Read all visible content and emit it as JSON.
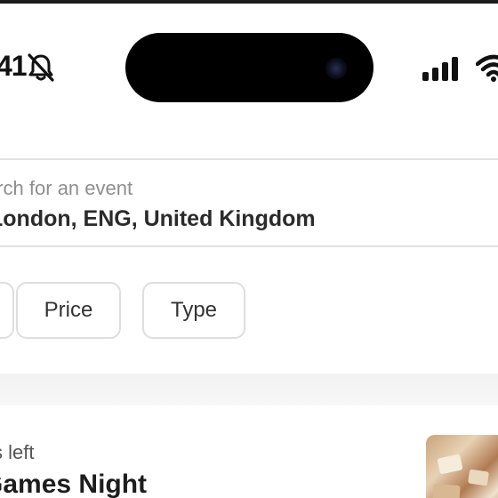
{
  "status_bar": {
    "time": "41",
    "icons": [
      "bell-slash-icon",
      "cellular-signal-icon",
      "wifi-icon"
    ]
  },
  "search": {
    "placeholder": "arch for an event",
    "location": "London, ENG, United Kingdom",
    "icon": "search-icon"
  },
  "filters": {
    "items": [
      {
        "label": ""
      },
      {
        "label": "Price"
      },
      {
        "label": "Type"
      }
    ]
  },
  "event_card": {
    "meta": "s left",
    "title": "Games Night",
    "image": "event-thumbnail"
  },
  "colors": {
    "text_primary": "#1d1d1d",
    "text_muted": "#8e8e8e",
    "border": "#dedede",
    "island": "#000000"
  }
}
